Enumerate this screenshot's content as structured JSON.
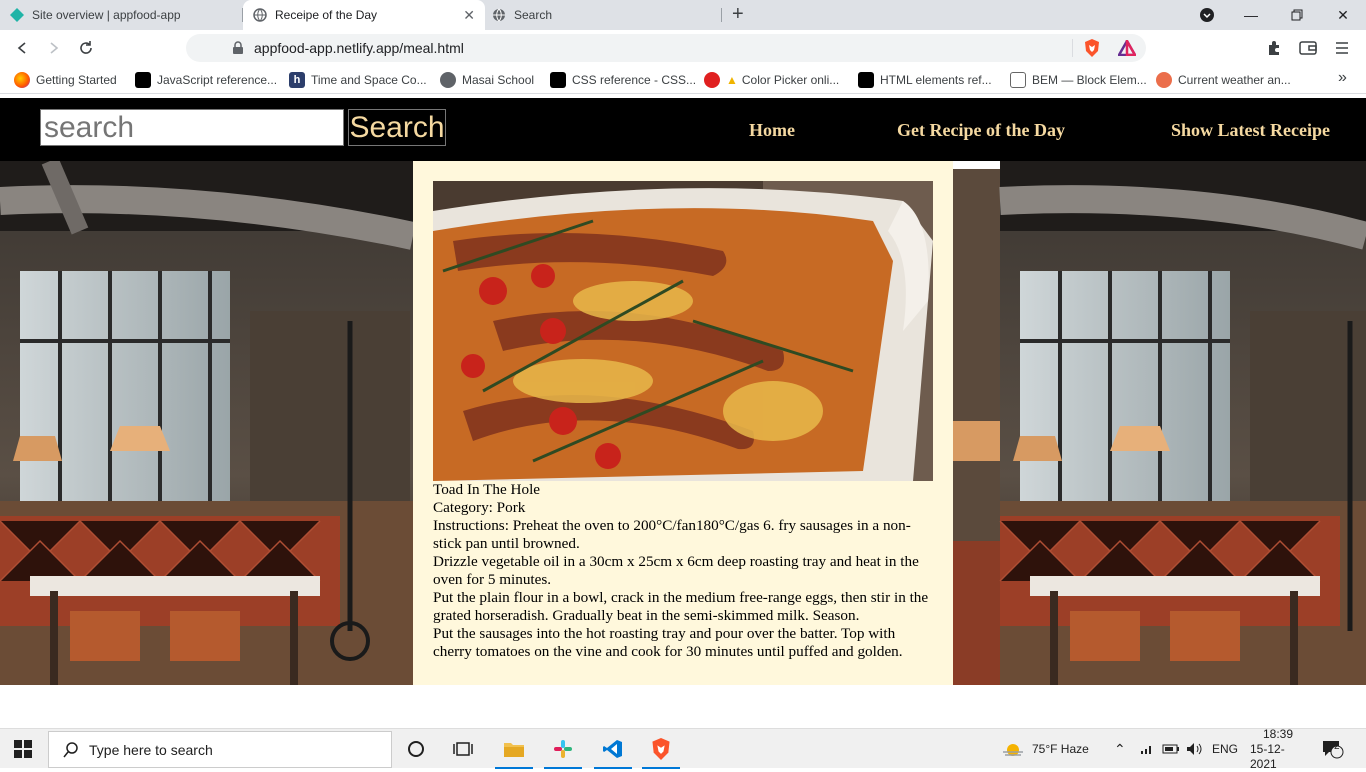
{
  "browser": {
    "tabs": [
      {
        "title": "Site overview | appfood-app",
        "active": false
      },
      {
        "title": "Receipe of the Day",
        "active": true
      },
      {
        "title": "Search",
        "active": false
      }
    ],
    "url": "appfood-app.netlify.app/meal.html",
    "bookmarks": [
      "Getting Started",
      "JavaScript reference...",
      "Time and Space Co...",
      "Masai School",
      "CSS reference - CSS...",
      "Color Picker onli...",
      "HTML elements ref...",
      "BEM — Block Elem...",
      "Current weather an..."
    ],
    "icons": [
      "back-icon",
      "forward-icon",
      "reload-icon",
      "bookmark-icon",
      "lock-icon",
      "brave-shield-icon",
      "brave-rewards-icon",
      "extensions-icon",
      "wallet-icon",
      "menu-icon"
    ]
  },
  "site": {
    "search_placeholder": "search",
    "search_button": "Search",
    "nav": [
      "Home",
      "Get Recipe of the Day",
      "Show Latest Receipe"
    ]
  },
  "meal": {
    "name": "Toad In The Hole",
    "category": "Category: Pork",
    "instructions": [
      "Instructions: Preheat the oven to 200°C/fan180°C/gas 6. fry sausages in a non-stick pan until browned.",
      "Drizzle vegetable oil in a 30cm x 25cm x 6cm deep roasting tray and heat in the oven for 5 minutes.",
      "Put the plain flour in a bowl, crack in the medium free-range eggs, then stir in the grated horseradish. Gradually beat in the semi-skimmed milk. Season.",
      "Put the sausages into the hot roasting tray and pour over the batter. Top with cherry tomatoes on the vine and cook for 30 minutes until puffed and golden."
    ]
  },
  "taskbar": {
    "search_placeholder": "Type here to search",
    "weather": "75°F  Haze",
    "language": "ENG",
    "time": "18:39",
    "date": "15-12-2021",
    "notifications": "2"
  },
  "colors": {
    "header_bg": "#000000",
    "nav_text": "#f5d9a1",
    "card_bg": "#fff8dc"
  }
}
